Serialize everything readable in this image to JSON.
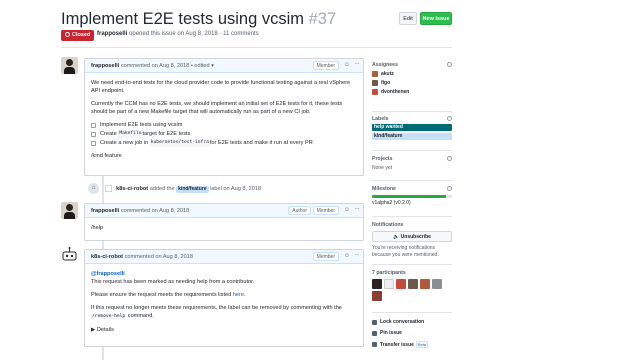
{
  "issue": {
    "title": "Implement E2E tests using vcsim",
    "number": "#37",
    "status": "Closed",
    "author": "frapposelli",
    "meta_text": "opened this issue on Aug 8, 2018 · 11 comments",
    "edit_label": "Edit",
    "new_issue_label": "New issue"
  },
  "comments": [
    {
      "author": "frapposelli",
      "header_text": "commented on Aug 8, 2018 • edited ▾",
      "role": "Member",
      "body": {
        "p1": "We need end-to-end tests for the cloud provider code to provide functional testing against a real vSphere API endpoint.",
        "p2": "Currently the CCM has no E2E tests, we should implement an initial set of E2E tests for it, these tests should be part of a new Makefile target that will automatically run as part of a new CI job.",
        "tasks": [
          {
            "pre": "Implement E2E tests using vcsim",
            "code": "",
            "post": ""
          },
          {
            "pre": "Create ",
            "code": "Makefile",
            "post": " target for E2E tests"
          },
          {
            "pre": "Create a new job in ",
            "code": "kubernetes/test-infra",
            "post": " for E2E tests and make it run at every PR"
          }
        ],
        "p3": "/kind feature"
      }
    },
    {
      "author": "frapposelli",
      "header_text": "commented on Aug 8, 2018",
      "role_author": "Author",
      "role": "Member",
      "body": "/help"
    },
    {
      "author": "k8s-ci-robot",
      "header_text": "commented on Aug 8, 2018",
      "role": "Member",
      "body": {
        "mention": "@frapposelli",
        "l1": "This request has been marked as needing help from a contributor.",
        "l2_pre": "Please ensure the request meets the requirements listed ",
        "l2_link": "here",
        "l2_post": ".",
        "l3": "If this request no longer meets these requirements, the label can be removed by commenting with the",
        "l3_code": "/remove-help",
        "l3_post": "command.",
        "details": "▶ Details"
      }
    }
  ],
  "event": {
    "actor": "k8s-ci-robot",
    "pre": "added the",
    "label": "kind/feature",
    "post": "label on Aug 8, 2018"
  },
  "sidebar": {
    "assignees_title": "Assignees",
    "assignees": [
      "akutz",
      "figo",
      "dvonthenen"
    ],
    "labels_title": "Labels",
    "labels": [
      "help wanted",
      "kind/feature"
    ],
    "projects_title": "Projects",
    "projects_value": "None yet",
    "milestone_title": "Milestone",
    "milestone_value": "v1alpha2 (v0.2.0)",
    "milestone_progress": 0.92,
    "notifications_title": "Notifications",
    "unsubscribe_label": "🔈 Unsubscribe",
    "notif_text": "You're receiving notifications because you were mentioned.",
    "participants_title": "7 participants",
    "lock_label": "Lock conversation",
    "pin_label": "Pin issue",
    "transfer_label": "Transfer issue",
    "beta_label": "Beta"
  },
  "colors": {
    "closed": "#cb2431",
    "new_issue": "#2cbe4e",
    "help_wanted": "#006b75",
    "kind_feature": "#c7def8",
    "link": "#0366d6"
  }
}
